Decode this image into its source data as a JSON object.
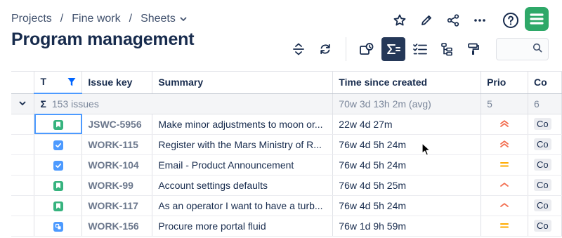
{
  "breadcrumb": {
    "items": [
      "Projects",
      "Fine work",
      "Sheets"
    ],
    "separator": "/"
  },
  "page": {
    "title": "Program management"
  },
  "top_actions": [
    "star-icon",
    "pencil-icon",
    "share-icon",
    "more-icon",
    "help-icon"
  ],
  "toolbar": [
    "expand-collapse-icon",
    "refresh-icon",
    "schedule-icon",
    "sum-icon",
    "checklist-icon",
    "hierarchy-icon",
    "paint-roller-icon",
    "search-icon"
  ],
  "table": {
    "headers": {
      "type": "T",
      "key": "Issue key",
      "summary": "Summary",
      "time": "Time since created",
      "prio": "Prio",
      "component": "Co"
    },
    "group": {
      "sigma": "Σ",
      "count": "153 issues",
      "time": "70w 3d 13h 2m (avg)",
      "prio": "5",
      "component": "6"
    },
    "rows": [
      {
        "type": "story",
        "key": "JSWC-5956",
        "summary": "Make minor adjustments to moon or...",
        "time": "22w 4d 27m",
        "prio": "highest",
        "component": "Co"
      },
      {
        "type": "task",
        "key": "WORK-115",
        "summary": "Register with the Mars Ministry of R...",
        "time": "76w 4d 5h 24m",
        "prio": "highest",
        "component": "Co"
      },
      {
        "type": "task",
        "key": "WORK-104",
        "summary": "Email - Product Announcement",
        "time": "76w 4d 5h 24m",
        "prio": "medium",
        "component": "Co"
      },
      {
        "type": "story",
        "key": "WORK-99",
        "summary": "Account settings defaults",
        "time": "76w 4d 5h 25m",
        "prio": "high",
        "component": "Co"
      },
      {
        "type": "story",
        "key": "WORK-117",
        "summary": "As an operator I want to have a turb...",
        "time": "76w 4d 5h 24m",
        "prio": "high",
        "component": "Co"
      },
      {
        "type": "subtask",
        "key": "WORK-156",
        "summary": "Procure more portal fluid",
        "time": "76w 1d 9h 59m",
        "prio": "medium",
        "component": "Co"
      }
    ]
  },
  "colors": {
    "story": "#36b37e",
    "task": "#4c9aff",
    "subtask": "#4c9aff",
    "prio_high": "#f26d4f",
    "prio_medium": "#ffab00",
    "logo": "#2ea868",
    "active_toolbar": "#253858"
  }
}
